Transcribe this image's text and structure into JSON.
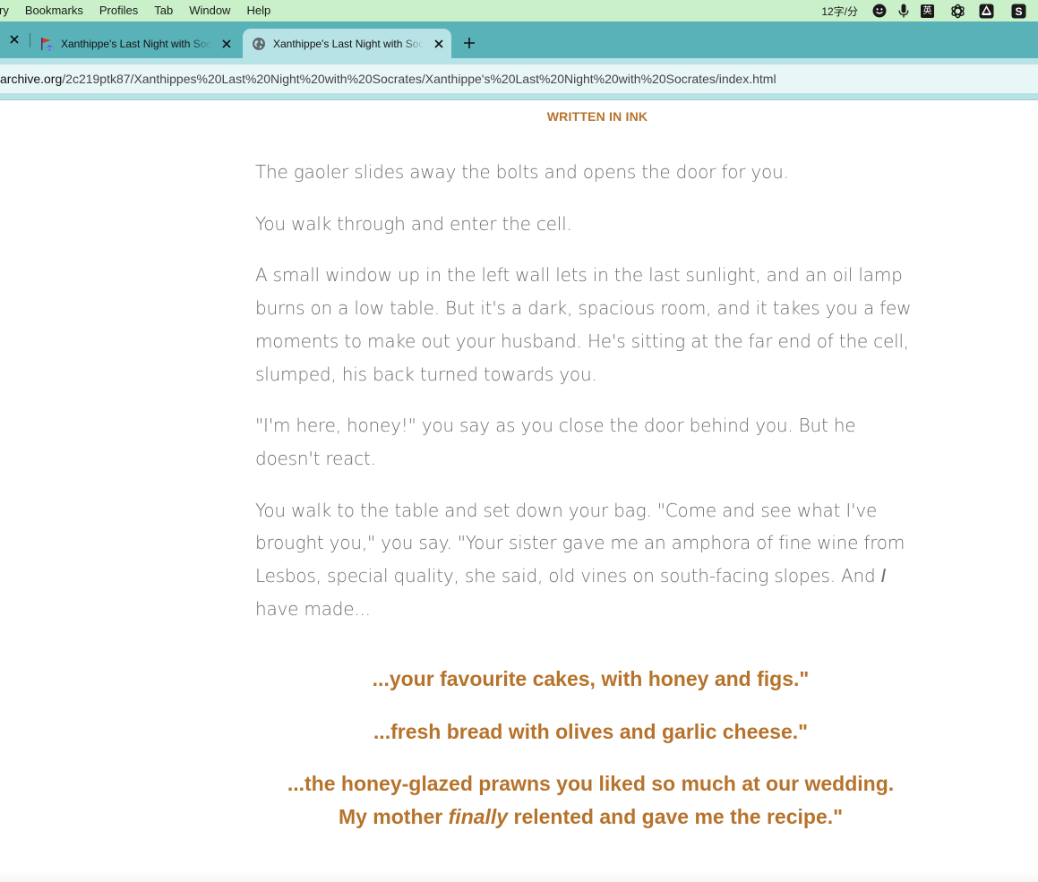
{
  "menubar": {
    "items": [
      "ry",
      "Bookmarks",
      "Profiles",
      "Tab",
      "Window",
      "Help"
    ],
    "status_text": "12字/分",
    "ime_label": "英",
    "status_icons": [
      "smiley-icon",
      "microphone-icon",
      "input-method-icon",
      "openai-icon",
      "drive-icon",
      "s-app-icon"
    ]
  },
  "tabs": [
    {
      "title": "Xanthippe's Last Night with Socrates",
      "favicon": "itch-flag-icon",
      "active": false
    },
    {
      "title": "Xanthippe's Last Night with Socrates",
      "favicon": "globe-icon",
      "active": true
    }
  ],
  "address_bar": {
    "host": "archive.org",
    "path": "/2c219ptk87/Xanthippes%20Last%20Night%20with%20Socrates/Xanthippe's%20Last%20Night%20with%20Socrates/index.html"
  },
  "page": {
    "heading": "WRITTEN IN INK",
    "paragraphs": [
      "The gaoler slides away the bolts and opens the door for you.",
      "You walk through and enter the cell.",
      "A small window up in the left wall lets in the last sunlight, and an oil lamp burns on a low table. But it's a dark, spacious room, and it takes you a few moments to make out your husband. He's sitting at the far end of the cell, slumped, his back turned towards you.",
      "\"I'm here, honey!\" you say as you close the door behind you. But he doesn't react."
    ],
    "last_paragraph": {
      "before": "You walk to the table and set down your bag. \"Come and see what I've brought you,\" you say. \"Your sister gave me an amphora of fine wine from Lesbos, special quality, she said, old vines on south-facing slopes. And ",
      "emphasis": "I",
      "after": " have made..."
    },
    "choices": [
      {
        "text": "...your favourite cakes, with honey and figs.\""
      },
      {
        "text": "...fresh bread with olives and garlic cheese.\""
      },
      {
        "line1": "...the honey-glazed prawns you liked so much at our wedding.",
        "line2_before": "My mother ",
        "line2_emphasis": "finally",
        "line2_after": " relented and gave me the recipe.\""
      }
    ]
  },
  "colors": {
    "menubar_bg": "#c9f0c9",
    "tabstrip_bg": "#5ab2b9",
    "active_tab_bg": "#b8e3e6",
    "url_field_bg": "#e9f6f6",
    "accent": "#b6732c",
    "body_text": "#6f6f6f"
  }
}
